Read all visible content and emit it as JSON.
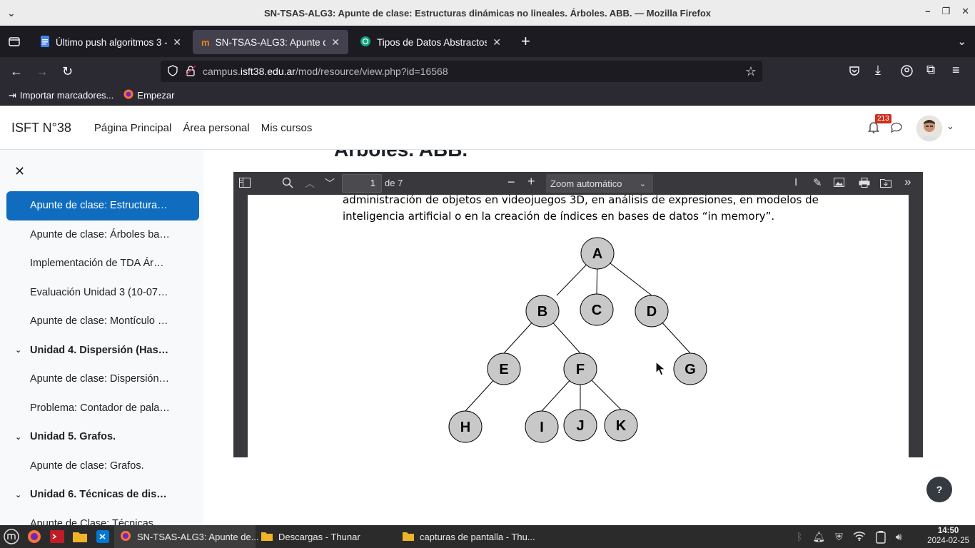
{
  "window": {
    "title": "SN-TSAS-ALG3: Apunte de clase: Estructuras dinámicas no lineales. Árboles. ABB. — Mozilla Firefox"
  },
  "tabs": [
    {
      "label": "Último push algoritmos 3 - ",
      "active": false
    },
    {
      "label": "SN-TSAS-ALG3: Apunte de c",
      "active": true
    },
    {
      "label": "Tipos de Datos Abstractos",
      "active": false
    }
  ],
  "url": {
    "prefix": "campus.",
    "domain": "isft38.edu.ar",
    "path": "/mod/resource/view.php?id=16568"
  },
  "bookmarks": [
    {
      "label": "Importar marcadores..."
    },
    {
      "label": "Empezar"
    }
  ],
  "site": {
    "brand": "ISFT N°38",
    "nav": [
      "Página Principal",
      "Área personal",
      "Mis cursos"
    ],
    "notification_count": "213"
  },
  "sidebar": {
    "items": [
      {
        "label": "Apunte de clase: Estructura…",
        "type": "active"
      },
      {
        "label": "Apunte de clase: Árboles ba…",
        "type": "item"
      },
      {
        "label": "Implementación de TDA Ár…",
        "type": "item"
      },
      {
        "label": "Evaluación Unidad 3 (10-07…",
        "type": "item"
      },
      {
        "label": "Apunte de clase: Montículo …",
        "type": "item"
      },
      {
        "label": "Unidad 4. Dispersión (Has…",
        "type": "section"
      },
      {
        "label": "Apunte de clase: Dispersión…",
        "type": "item"
      },
      {
        "label": "Problema: Contador de pala…",
        "type": "item"
      },
      {
        "label": "Unidad 5. Grafos.",
        "type": "section"
      },
      {
        "label": "Apunte de clase: Grafos.",
        "type": "item"
      },
      {
        "label": "Unidad 6. Técnicas de dis…",
        "type": "section"
      },
      {
        "label": "Apunte de Clase: Técnicas …",
        "type": "item"
      }
    ]
  },
  "main": {
    "heading": "Árboles. ABB."
  },
  "pdf": {
    "page": "1",
    "page_total": "de 7",
    "zoom": "Zoom automático",
    "text_lines": [
      "administración de objetos en videojuegos 3D, en análisis de expresiones, en modelos de",
      "inteligencia artificial o en la creación de índices en bases de datos “in memory”."
    ],
    "tree_nodes": [
      "A",
      "B",
      "C",
      "D",
      "E",
      "F",
      "G",
      "H",
      "I",
      "J",
      "K"
    ]
  },
  "help_label": "?",
  "taskbar": {
    "tasks": [
      "SN-TSAS-ALG3: Apunte de...",
      "Descargas - Thunar",
      "capturas de pantalla - Thu..."
    ],
    "time": "14:50",
    "date": "2024-02-25"
  },
  "colors": {
    "accent": "#0f6cbf",
    "node_fill": "#c8c8c8",
    "badge": "#ca3120"
  }
}
